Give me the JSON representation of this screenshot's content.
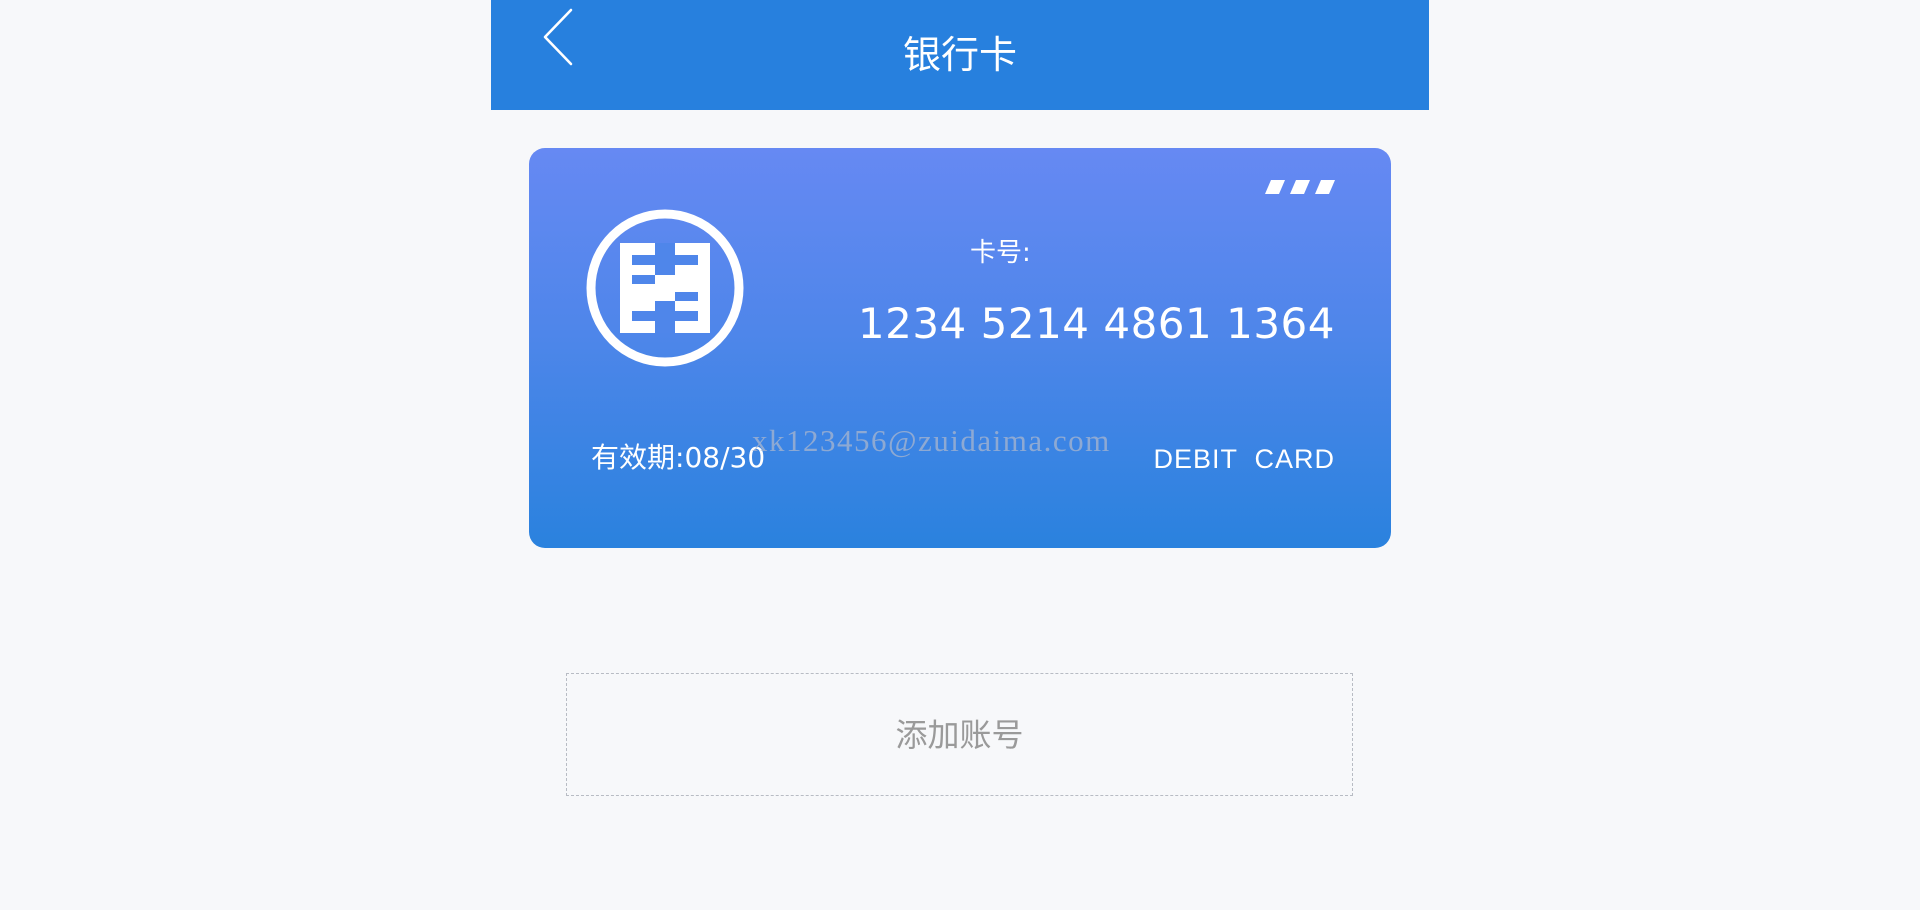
{
  "header": {
    "title": "银行卡",
    "background_color": "#2780de"
  },
  "card": {
    "number_label": "卡号:",
    "number": "1234 5214 4861 1364",
    "expiry_label": "有效期:",
    "expiry_value": "08/30",
    "type": "DEBIT  CARD",
    "logo_icon": "icbc-bank-logo-icon",
    "more_icon": "more-icon",
    "gradient_top": "#6689f3",
    "gradient_bottom": "#2a82de"
  },
  "watermark": "xk123456@zuidaima.com",
  "add_account": {
    "label": "添加账号"
  }
}
